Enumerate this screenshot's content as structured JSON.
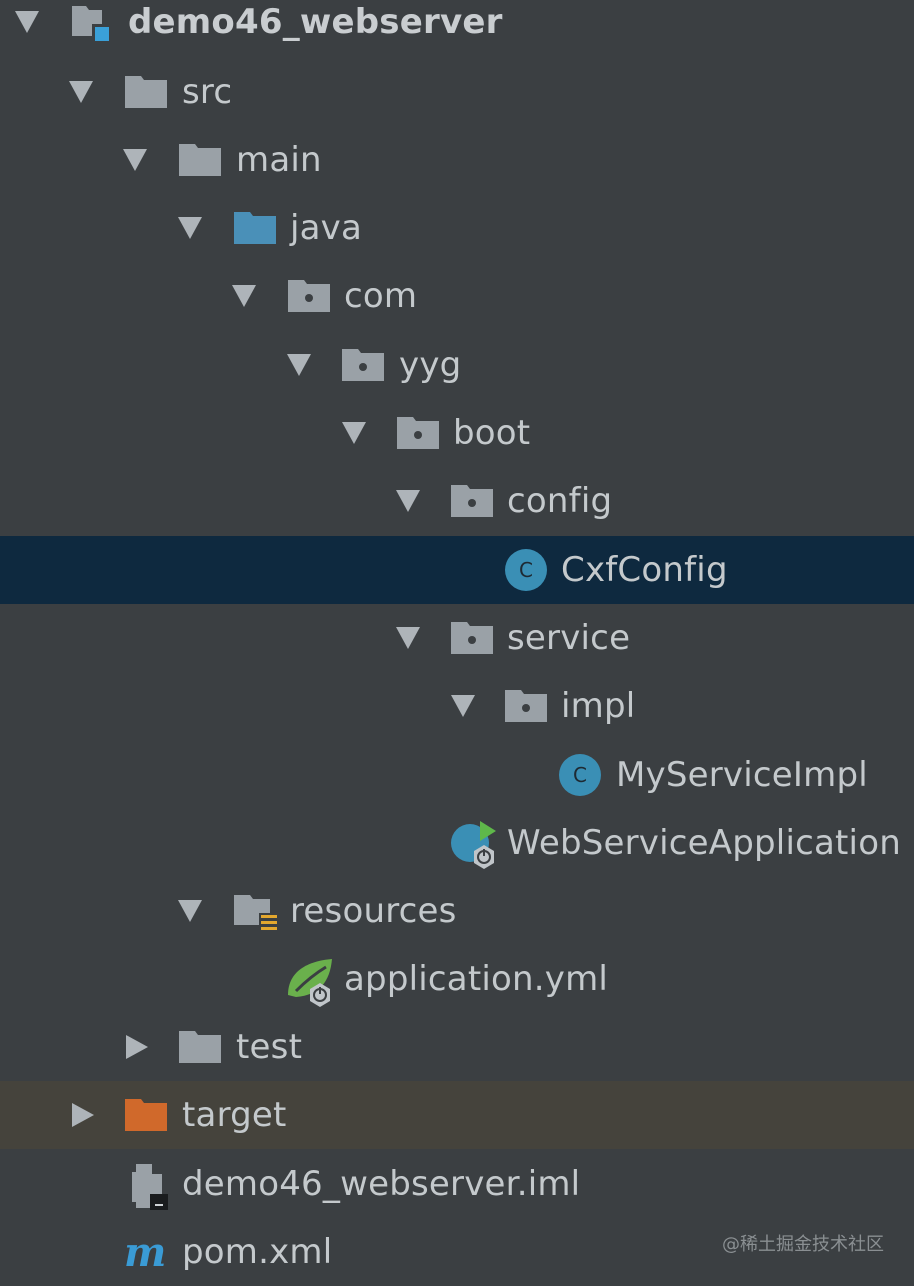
{
  "project_tree": {
    "root": "demo46_webserver",
    "nodes": {
      "src": "src",
      "main": "main",
      "java": "java",
      "com": "com",
      "yyg": "yyg",
      "boot": "boot",
      "config": "config",
      "cxf_config": "CxfConfig",
      "service": "service",
      "impl": "impl",
      "my_service_impl": "MyServiceImpl",
      "web_service_application": "WebServiceApplication",
      "resources": "resources",
      "application_yml": "application.yml",
      "test": "test",
      "target": "target",
      "iml_file": "demo46_webserver.iml",
      "pom": "pom.xml"
    },
    "class_badge": "C"
  },
  "watermark": "@稀土掘金技术社区",
  "colors": {
    "background": "#3b3f42",
    "selected_row": "#0e293f",
    "excluded_row": "#45433c",
    "folder": "#9aa1a7",
    "source_folder": "#4a90b8",
    "excluded_folder": "#d0692b",
    "class_icon": "#3a8fb5",
    "spring_green": "#6ab04c"
  },
  "icons": {
    "root": "module-folder-icon",
    "folder": "folder-icon",
    "source_folder": "source-root-folder-icon",
    "package": "package-icon",
    "class": "class-icon",
    "spring_boot_app": "spring-boot-run-icon",
    "resources": "resources-folder-icon",
    "spring_config": "spring-yaml-icon",
    "excluded": "excluded-folder-icon",
    "iml": "iml-file-icon",
    "maven": "maven-pom-icon"
  }
}
